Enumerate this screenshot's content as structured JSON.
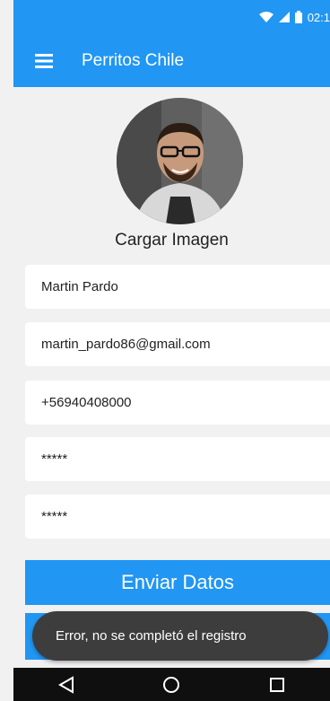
{
  "status_bar": {
    "time": "02:1",
    "icons": [
      "wifi-icon",
      "signal-icon",
      "battery-icon"
    ]
  },
  "app_bar": {
    "menu_icon": "hamburger-menu-icon",
    "title": "Perritos Chile"
  },
  "profile": {
    "upload_label": "Cargar Imagen"
  },
  "form": {
    "name_value": "Martin Pardo",
    "email_value": "martin_pardo86@gmail.com",
    "phone_value": "+56940408000",
    "password_value": "*****",
    "confirm_password_value": "*****"
  },
  "submit_label": "Enviar Datos",
  "toast": {
    "message": "Error, no se completó el registro"
  },
  "nav_bar": {
    "buttons": [
      "back-icon",
      "home-icon",
      "recents-icon"
    ]
  },
  "colors": {
    "primary": "#2196f3",
    "background": "#f1f1f1",
    "toast": "#3d3d3d",
    "nav": "#0f0f0f"
  }
}
